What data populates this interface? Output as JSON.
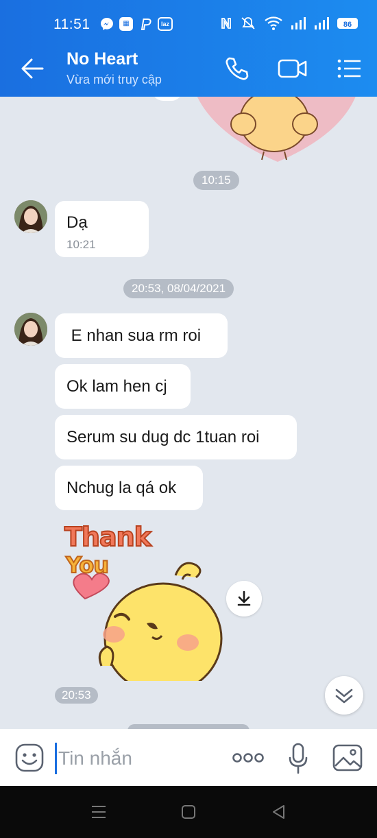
{
  "status_bar": {
    "time": "11:51",
    "app_icons": [
      "messenger-icon",
      "store-icon",
      "paypal-icon",
      "lazada-icon"
    ],
    "lazada_label": "laz",
    "battery": "86"
  },
  "header": {
    "contact_name": "No Heart",
    "contact_status": "Vừa mới truy cập"
  },
  "chat": {
    "time_separator_1": "10:15",
    "message_1": {
      "text": "Dạ",
      "time": "10:21"
    },
    "date_separator": "20:53, 08/04/2021",
    "messages": [
      " E nhan sua rm roi",
      "Ok lam hen cj",
      "Serum su dug dc 1tuan roi",
      "Nchug la qá ok"
    ],
    "sticker": {
      "line1": "Thank",
      "line2": "You"
    },
    "sticker_time": "20:53"
  },
  "input_bar": {
    "placeholder": "Tin nhắn"
  },
  "colors": {
    "header_blue": "#1a6fe0",
    "chat_background": "#e2e7ee",
    "bubble": "#ffffff"
  }
}
